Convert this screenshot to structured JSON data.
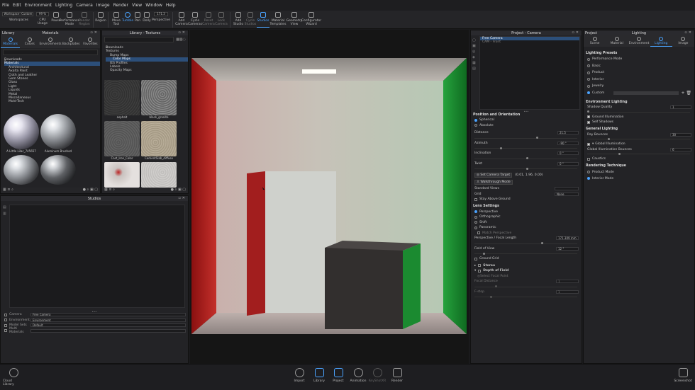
{
  "menu": [
    "File",
    "Edit",
    "Environment",
    "Lighting",
    "Camera",
    "Image",
    "Render",
    "View",
    "Window",
    "Help"
  ],
  "toolbar": {
    "workspace_value": "Workspace: Custom",
    "workspaces_label": "Workspaces",
    "cpu_value": "99 %",
    "cpu_label": "CPU Usage",
    "pause_label": "Pause",
    "perf_label": "Performance Mode",
    "render_region_label": "Render Region",
    "region_label": "Region",
    "move_tool_label": "Move Tool",
    "tumble_label": "Tumble",
    "pan_label": "Pan",
    "dolly_label": "Dolly",
    "perspective_label": "Perspective",
    "persp_value": "171.3",
    "add_camera_label": "Add Camera",
    "cycle_cameras_label": "Cycle Cameras",
    "reset_camera_label": "Reset Camera",
    "lock_camera_label": "Lock Camera",
    "add_studio_label": "Add Studio",
    "cycle_studios_label": "Cycle Studios",
    "studios_label": "Studios",
    "material_templates_label": "Material Templates",
    "geometry_view_label": "Geometry View",
    "configurator_label": "Configurator Wizard"
  },
  "library": {
    "title": "Library",
    "materials_title": "Materials",
    "tabs": [
      "Materials",
      "Colors",
      "Environments",
      "Backplates",
      "Favorites"
    ],
    "tree": [
      "Downloads",
      "Materials",
      "Architectural",
      "Axalta Paint",
      "Cloth and Leather",
      "Gem Stones",
      "Glass",
      "Light",
      "Liquids",
      "Metal",
      "Miscellaneous",
      "Mold-Tech"
    ],
    "thumbs": [
      "A Little Lilac_745657",
      "Aluminum Brushed",
      "",
      ""
    ]
  },
  "textures": {
    "title": "Library - Textures",
    "tree": [
      "Downloads",
      "Textures",
      "Bump Maps",
      "Color Maps",
      "IES Profiles",
      "Labels",
      "Opacity Maps"
    ],
    "thumbs": [
      "asphalt",
      "black_granite",
      "Cast_Iron_Color",
      "CementSlab_diffuse",
      "",
      ""
    ]
  },
  "studios": {
    "title": "Studios",
    "rows": [
      {
        "label": "Camera",
        "value": "Free Camera"
      },
      {
        "label": "Environment",
        "value": "Environment"
      },
      {
        "label": "Model Sets",
        "value": "Default"
      },
      {
        "label": "Multi Materials",
        "value": ""
      }
    ]
  },
  "project_camera": {
    "title": "Project - Camera",
    "list": [
      "Free Camera",
      "CAM - Front"
    ],
    "position_head": "Position and Orientation",
    "spherical": "Spherical",
    "absolute": "Absolute",
    "distance_label": "Distance",
    "distance_value": "21.5",
    "azimuth_label": "Azimuth",
    "azimuth_value": "-90 °",
    "inclination_label": "Inclination",
    "inclination_value": "0 °",
    "twist_label": "Twist",
    "twist_value": "0 °",
    "set_target": "Set Camera Target",
    "target_value": "(0.01, 1.96, 0.00)",
    "walkthrough": "Walkthrough Mode",
    "standard_views": "Standard Views",
    "grid_label": "Grid",
    "grid_value": "None",
    "stay_above": "Stay Above Ground",
    "lens_head": "Lens Settings",
    "perspective": "Perspective",
    "orthographic": "Orthographic",
    "shift": "Shift",
    "panoramic": "Panoramic",
    "match_persp": "Match Perspective",
    "focal_label": "Perspective / Focal Length",
    "focal_value": "171.309 mm",
    "fov_label": "Field of View",
    "fov_value": "12 °",
    "ground_grid": "Ground Grid",
    "stereo": "Stereo",
    "dof": "Depth of Field",
    "select_focal": "Select Focal Point",
    "focal_distance": "Focal Distance",
    "focal_distance_value": "1",
    "fstop": "F-stop",
    "fstop_value": "1"
  },
  "project_lighting": {
    "title": "Project",
    "lighting_title": "Lighting",
    "tabs": [
      "Scene",
      "Material",
      "Environment",
      "Lighting",
      "Image"
    ],
    "presets_head": "Lighting Presets",
    "presets": [
      "Performance Mode",
      "Basic",
      "Product",
      "Interior",
      "Jewelry",
      "Custom"
    ],
    "env_head": "Environment Lighting",
    "shadow_quality": "Shadow Quality",
    "shadow_value": "1",
    "ground_illum": "Ground Illumination",
    "self_shadows": "Self Shadows",
    "general_head": "General Lighting",
    "ray_bounces": "Ray Bounces",
    "ray_value": "30",
    "global_illum": "Global Illumination",
    "gi_bounces": "Global Illumination Bounces",
    "gi_value": "6",
    "caustics": "Caustics",
    "rendering_head": "Rendering Technique",
    "product_mode": "Product Mode",
    "interior_mode": "Interior Mode"
  },
  "bottom": {
    "cloud_library": "Cloud Library",
    "import": "Import",
    "library": "Library",
    "project": "Project",
    "animation": "Animation",
    "keyshotxr": "KeyShotXR",
    "render": "Render",
    "screenshot": "Screenshot"
  },
  "colors": {
    "accent": "#4aa3ff",
    "red_wall": "#b01e1e",
    "green_wall": "#1e9a36"
  }
}
